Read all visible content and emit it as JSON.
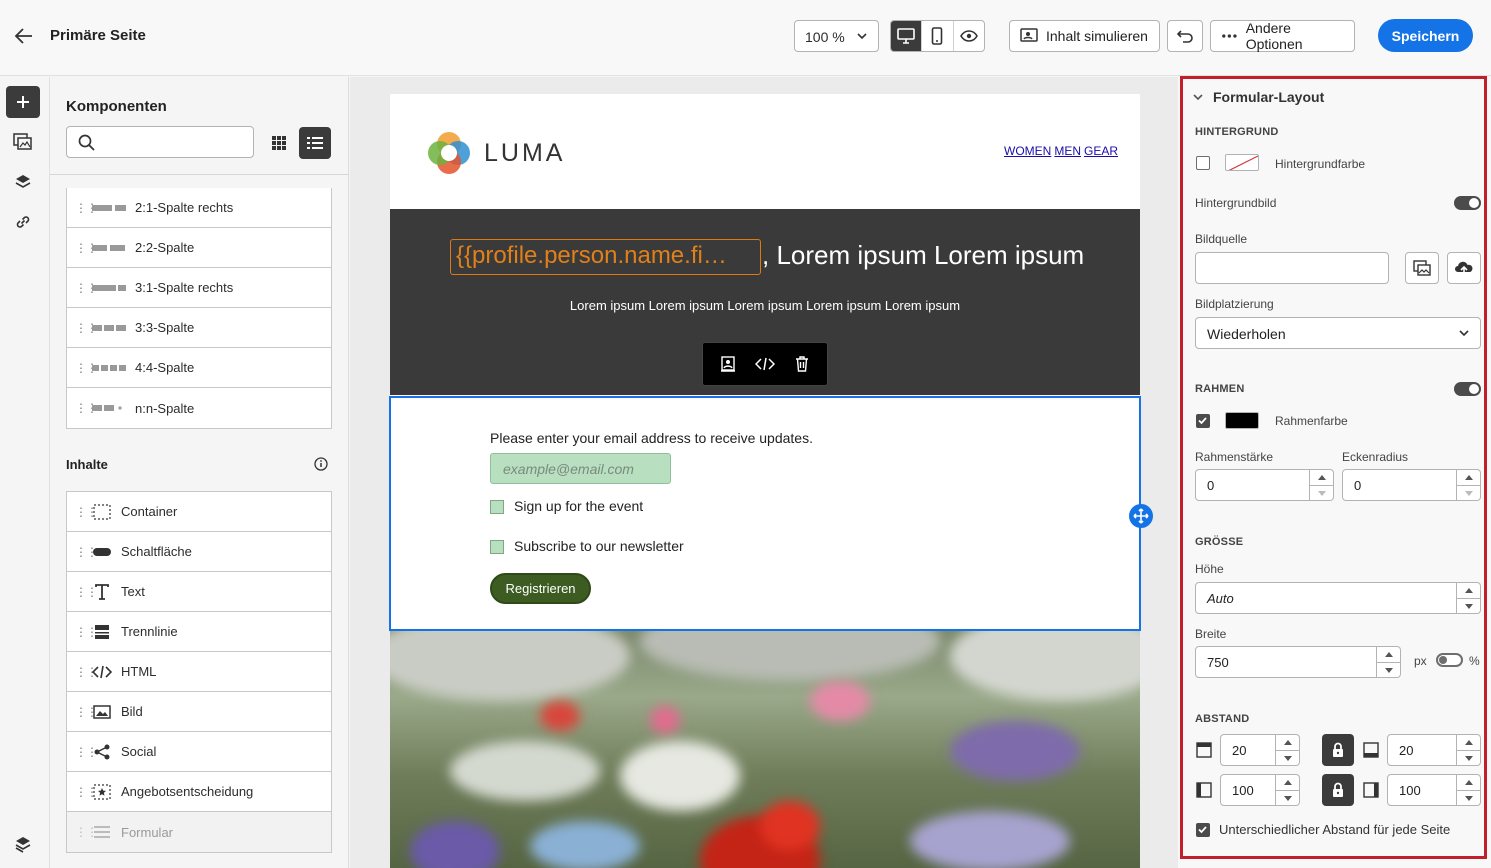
{
  "header": {
    "title": "Primäre Seite",
    "zoom": "100 %",
    "simulate_label": "Inhalt simulieren",
    "options_label": "Andere Optionen",
    "save_label": "Speichern"
  },
  "components": {
    "title": "Komponenten",
    "search_placeholder": "",
    "structure_items": [
      {
        "label": "2:1-Spalte rechts",
        "icon": "layout-2-1-icon"
      },
      {
        "label": "2:2-Spalte",
        "icon": "layout-2-2-icon"
      },
      {
        "label": "3:1-Spalte rechts",
        "icon": "layout-3-1-icon"
      },
      {
        "label": "3:3-Spalte",
        "icon": "layout-3-3-icon"
      },
      {
        "label": "4:4-Spalte",
        "icon": "layout-4-4-icon"
      },
      {
        "label": "n:n-Spalte",
        "icon": "layout-n-n-icon"
      }
    ],
    "content_title": "Inhalte",
    "content_items": [
      {
        "label": "Container",
        "icon": "container-icon"
      },
      {
        "label": "Schaltfläche",
        "icon": "button-icon"
      },
      {
        "label": "Text",
        "icon": "text-icon"
      },
      {
        "label": "Trennlinie",
        "icon": "divider-icon"
      },
      {
        "label": "HTML",
        "icon": "html-icon"
      },
      {
        "label": "Bild",
        "icon": "image-icon"
      },
      {
        "label": "Social",
        "icon": "social-icon"
      },
      {
        "label": "Angebotsentscheidung",
        "icon": "offer-icon"
      },
      {
        "label": "Formular",
        "icon": "form-icon"
      }
    ]
  },
  "email": {
    "logo_text": "LUMA",
    "nav": [
      "WOMEN",
      "MEN",
      "GEAR"
    ],
    "hero_token": "{{profile.person.name.fi…",
    "hero_title": ", Lorem ipsum Lorem ipsum",
    "hero_subtitle": "Lorem ipsum Lorem ipsum Lorem ipsum Lorem ipsum Lorem ipsum",
    "form_prompt": "Please enter your email address to receive updates.",
    "email_placeholder": "example@email.com",
    "checkbox1": "Sign up for the event",
    "checkbox2": "Subscribe to our newsletter",
    "submit_label": "Registrieren"
  },
  "properties": {
    "section_title": "Formular-Layout",
    "background": {
      "heading": "HINTERGRUND",
      "color_label": "Hintergrundfarbe",
      "image_label": "Hintergrundbild",
      "source_label": "Bildquelle",
      "source_value": "",
      "placement_label": "Bildplatzierung",
      "placement_value": "Wiederholen"
    },
    "border": {
      "heading": "RAHMEN",
      "color_label": "Rahmenfarbe",
      "color": "#000000",
      "width_label": "Rahmenstärke",
      "width_value": "0",
      "radius_label": "Eckenradius",
      "radius_value": "0"
    },
    "size": {
      "heading": "GRÖSSE",
      "height_label": "Höhe",
      "height_value": "Auto",
      "width_label": "Breite",
      "width_value": "750",
      "unit_px": "px",
      "unit_pct": "%"
    },
    "spacing": {
      "heading": "ABSTAND",
      "top": "20",
      "bottom": "20",
      "left": "100",
      "right": "100",
      "per_side_label": "Unterschiedlicher Abstand für jede Seite"
    }
  },
  "colors": {
    "accent": "#1473e6",
    "highlight_border": "#c0202a",
    "hero_bg": "#3a3a3a",
    "token": "#e0801a",
    "submit_bg": "#3d5c22",
    "field_bg": "#b8dfbf"
  }
}
